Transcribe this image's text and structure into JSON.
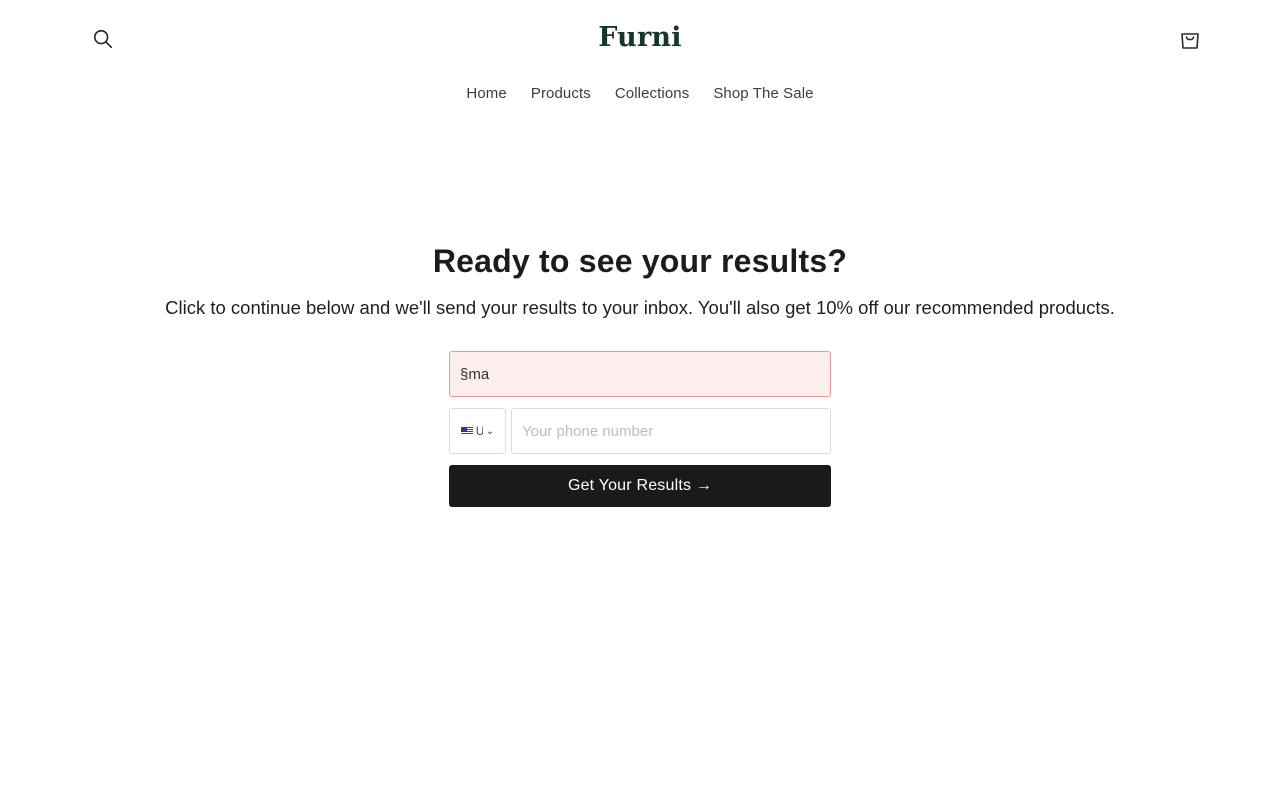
{
  "header": {
    "logo": "Furni",
    "search_icon": "search-icon",
    "cart_icon": "shopping-bag-icon"
  },
  "nav": {
    "items": [
      {
        "label": "Home"
      },
      {
        "label": "Products"
      },
      {
        "label": "Collections"
      },
      {
        "label": "Shop The Sale"
      }
    ]
  },
  "hero": {
    "title": "Ready to see your results?",
    "subtitle": "Click to continue below and we'll send your results to your inbox. You'll also get 10% off our recommended products."
  },
  "form": {
    "email_value": "§ma",
    "country_code": "U",
    "country_flag": "us-flag-icon",
    "phone_placeholder": "Your phone number",
    "submit_label": "Get Your Results →"
  },
  "colors": {
    "logo": "#17352a",
    "button_bg": "#1a1a1c",
    "input_error_border": "#e29a9a",
    "input_error_bg": "#fdeeee"
  }
}
